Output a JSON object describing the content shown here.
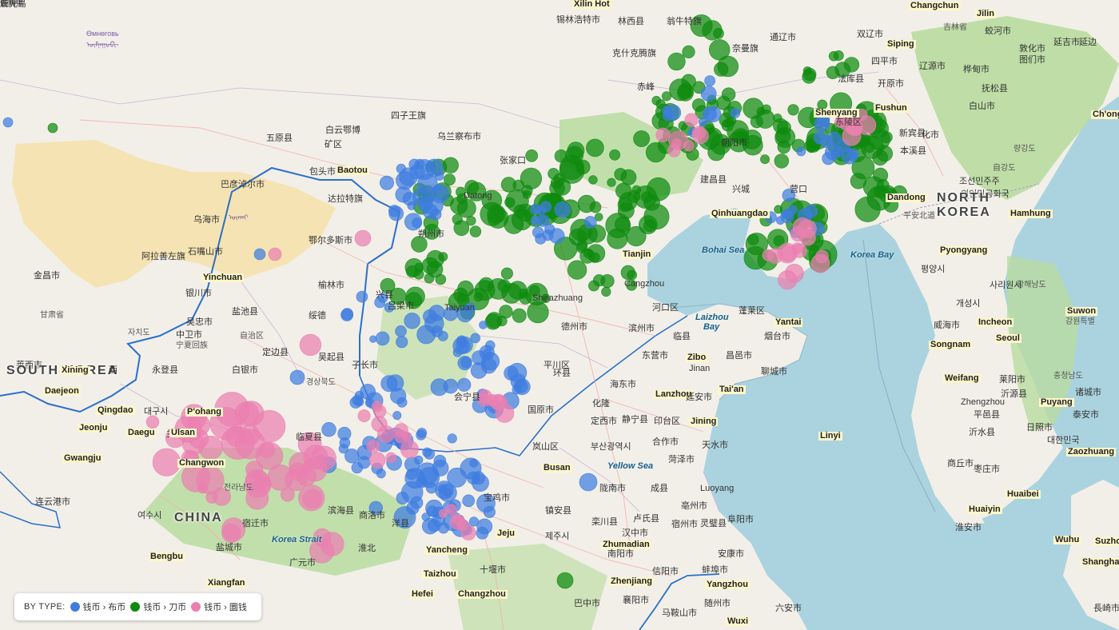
{
  "legend": {
    "title": "BY TYPE:",
    "items": [
      {
        "label": "钱币 › 布币",
        "color": "#3e7de0"
      },
      {
        "label": "钱币 › 刀币",
        "color": "#0e8a0e"
      },
      {
        "label": "钱币 › 圜钱",
        "color": "#ea7fb0"
      }
    ]
  },
  "colors": {
    "water": "#aad3df",
    "land": "#f2efe9",
    "steppe": "#f5e3b3",
    "green": "#b9dca0"
  },
  "labels": [
    {
      "text": "Xilin Hot",
      "cls": "hl"
    },
    {
      "text": "锡林浩特市",
      "cls": ""
    },
    {
      "text": "Changchun",
      "cls": "hl"
    },
    {
      "text": "Jilin",
      "cls": "hl"
    },
    {
      "text": "Өмнөговь",
      "cls": "mong"
    },
    {
      "text": "ᠥᠮᠨᠡᠭᠣᠪᠢ",
      "cls": "mong"
    },
    {
      "text": "林西县",
      "cls": ""
    },
    {
      "text": "翁牛特旗",
      "cls": ""
    },
    {
      "text": "克什克腾旗",
      "cls": ""
    },
    {
      "text": "奈曼旗",
      "cls": ""
    },
    {
      "text": "通辽市",
      "cls": ""
    },
    {
      "text": "双辽市",
      "cls": ""
    },
    {
      "text": "吉林省",
      "cls": "small"
    },
    {
      "text": "蛟河市",
      "cls": ""
    },
    {
      "text": "延吉市",
      "cls": ""
    },
    {
      "text": "延边",
      "cls": ""
    },
    {
      "text": "Siping",
      "cls": "hl"
    },
    {
      "text": "四平市",
      "cls": ""
    },
    {
      "text": "辽源市",
      "cls": ""
    },
    {
      "text": "桦甸市",
      "cls": ""
    },
    {
      "text": "敦化市",
      "cls": ""
    },
    {
      "text": "图们市",
      "cls": ""
    },
    {
      "text": "白山市",
      "cls": ""
    },
    {
      "text": "赤峰",
      "cls": ""
    },
    {
      "text": "法库县",
      "cls": ""
    },
    {
      "text": "开原市",
      "cls": ""
    },
    {
      "text": "抚松县",
      "cls": ""
    },
    {
      "text": "四子王旗",
      "cls": ""
    },
    {
      "text": "五原县",
      "cls": ""
    },
    {
      "text": "白云鄂博",
      "cls": ""
    },
    {
      "text": "矿区",
      "cls": ""
    },
    {
      "text": "乌兰察布市",
      "cls": ""
    },
    {
      "text": "Baotou",
      "cls": "hl"
    },
    {
      "text": "包头市",
      "cls": ""
    },
    {
      "text": "巴彦淖尔市",
      "cls": ""
    },
    {
      "text": "达拉特旗",
      "cls": ""
    },
    {
      "text": "张家口",
      "cls": ""
    },
    {
      "text": "Datong",
      "cls": ""
    },
    {
      "text": "朝阳市",
      "cls": ""
    },
    {
      "text": "Shenyang",
      "cls": "hl"
    },
    {
      "text": "Fushun",
      "cls": "hl"
    },
    {
      "text": "东陵区",
      "cls": ""
    },
    {
      "text": "新宾县",
      "cls": ""
    },
    {
      "text": "本溪县",
      "cls": ""
    },
    {
      "text": "化市",
      "cls": ""
    },
    {
      "text": "Ch'ong",
      "cls": "hl"
    },
    {
      "text": "량강도",
      "cls": "small"
    },
    {
      "text": "조선민주주",
      "cls": ""
    },
    {
      "text": "의인민공화국",
      "cls": ""
    },
    {
      "text": "自강도",
      "cls": "small"
    },
    {
      "text": "NORTH",
      "cls": "big"
    },
    {
      "text": "KOREA",
      "cls": "big"
    },
    {
      "text": "Hamhung",
      "cls": "hl"
    },
    {
      "text": "Dandong",
      "cls": "hl"
    },
    {
      "text": "平安北道",
      "cls": "small"
    },
    {
      "text": "乌海市",
      "cls": ""
    },
    {
      "text": "ᠦᠬᠠᠢ",
      "cls": "mong"
    },
    {
      "text": "鄂尔多斯市",
      "cls": ""
    },
    {
      "text": "阿拉善左旗",
      "cls": ""
    },
    {
      "text": "石嘴山市",
      "cls": ""
    },
    {
      "text": "朔州市",
      "cls": ""
    },
    {
      "text": "建昌县",
      "cls": ""
    },
    {
      "text": "兴城",
      "cls": ""
    },
    {
      "text": "营口",
      "cls": ""
    },
    {
      "text": "Qinhuangdao",
      "cls": "hl"
    },
    {
      "text": "Bohai Sea",
      "cls": "sea"
    },
    {
      "text": "Korea Bay",
      "cls": "sea"
    },
    {
      "text": "Pyongyang",
      "cls": "hl"
    },
    {
      "text": "평양시",
      "cls": ""
    },
    {
      "text": "金昌市",
      "cls": ""
    },
    {
      "text": "Yinchuan",
      "cls": "hl"
    },
    {
      "text": "银川市",
      "cls": ""
    },
    {
      "text": "甘肃省",
      "cls": "small"
    },
    {
      "text": "榆林市",
      "cls": ""
    },
    {
      "text": "Tianjin",
      "cls": "hl"
    },
    {
      "text": "Cangzhou",
      "cls": ""
    },
    {
      "text": "황해남도",
      "cls": "small"
    },
    {
      "text": "사리원시",
      "cls": ""
    },
    {
      "text": "개성시",
      "cls": ""
    },
    {
      "text": "盐池县",
      "cls": ""
    },
    {
      "text": "吴忠市",
      "cls": ""
    },
    {
      "text": "绥德",
      "cls": ""
    },
    {
      "text": "兴县",
      "cls": ""
    },
    {
      "text": "吕梁市",
      "cls": ""
    },
    {
      "text": "Taiyuan",
      "cls": ""
    },
    {
      "text": "Shijiazhuang",
      "cls": ""
    },
    {
      "text": "德州市",
      "cls": ""
    },
    {
      "text": "滨州市",
      "cls": ""
    },
    {
      "text": "河口区",
      "cls": ""
    },
    {
      "text": "蓬莱区",
      "cls": ""
    },
    {
      "text": "Laizhou",
      "cls": "sea"
    },
    {
      "text": "Bay",
      "cls": "sea"
    },
    {
      "text": "Yantai",
      "cls": "hl"
    },
    {
      "text": "烟台市",
      "cls": ""
    },
    {
      "text": "威海市",
      "cls": ""
    },
    {
      "text": "Incheon",
      "cls": "hl"
    },
    {
      "text": "Seoul",
      "cls": "hl"
    },
    {
      "text": "Songnam",
      "cls": "hl"
    },
    {
      "text": "Suwon",
      "cls": "hl"
    },
    {
      "text": "강원특별",
      "cls": "small"
    },
    {
      "text": "자치도",
      "cls": "small"
    },
    {
      "text": "中卫市",
      "cls": ""
    },
    {
      "text": "宁夏回族",
      "cls": "small"
    },
    {
      "text": "自治区",
      "cls": "small"
    },
    {
      "text": "定边县",
      "cls": ""
    },
    {
      "text": "吴起县",
      "cls": ""
    },
    {
      "text": "子长市",
      "cls": ""
    },
    {
      "text": "临县",
      "cls": ""
    },
    {
      "text": "东营市",
      "cls": ""
    },
    {
      "text": "Zibo",
      "cls": "hl"
    },
    {
      "text": "昌邑市",
      "cls": ""
    },
    {
      "text": "莱西市",
      "cls": ""
    },
    {
      "text": "SOUTH KOREA",
      "cls": "big"
    },
    {
      "text": "Xining",
      "cls": "hl"
    },
    {
      "text": "西",
      "cls": ""
    },
    {
      "text": "永登县",
      "cls": ""
    },
    {
      "text": "白银市",
      "cls": ""
    },
    {
      "text": "平川区",
      "cls": ""
    },
    {
      "text": "环县",
      "cls": ""
    },
    {
      "text": "Jinan",
      "cls": ""
    },
    {
      "text": "聊城市",
      "cls": ""
    },
    {
      "text": "Weifang",
      "cls": "hl"
    },
    {
      "text": "莱阳市",
      "cls": ""
    },
    {
      "text": "충청남도",
      "cls": "small"
    },
    {
      "text": "Daejeon",
      "cls": "hl"
    },
    {
      "text": "경상북도",
      "cls": "small"
    },
    {
      "text": "海东市",
      "cls": ""
    },
    {
      "text": "Lanzhou",
      "cls": "hl"
    },
    {
      "text": "延安市",
      "cls": ""
    },
    {
      "text": "Tai'an",
      "cls": "hl"
    },
    {
      "text": "沂源县",
      "cls": ""
    },
    {
      "text": "诸城市",
      "cls": ""
    },
    {
      "text": "Qingdao",
      "cls": "hl"
    },
    {
      "text": "대구시",
      "cls": ""
    },
    {
      "text": "P'ohang",
      "cls": "hl"
    },
    {
      "text": "兰州市",
      "cls": ""
    },
    {
      "text": "会宁县",
      "cls": ""
    },
    {
      "text": "国原市",
      "cls": ""
    },
    {
      "text": "化隆",
      "cls": ""
    },
    {
      "text": "Zhengzhou",
      "cls": ""
    },
    {
      "text": "Puyang",
      "cls": "hl"
    },
    {
      "text": "泰安市",
      "cls": ""
    },
    {
      "text": "Jeonju",
      "cls": "hl"
    },
    {
      "text": "Daegu",
      "cls": "hl"
    },
    {
      "text": "Ulsan",
      "cls": "hl"
    },
    {
      "text": "临夏县",
      "cls": ""
    },
    {
      "text": "定西市",
      "cls": ""
    },
    {
      "text": "静宁县",
      "cls": ""
    },
    {
      "text": "印台区",
      "cls": ""
    },
    {
      "text": "Jining",
      "cls": "hl"
    },
    {
      "text": "平邑县",
      "cls": ""
    },
    {
      "text": "沂水县",
      "cls": ""
    },
    {
      "text": "日照市",
      "cls": ""
    },
    {
      "text": "대한민국",
      "cls": ""
    },
    {
      "text": "Gwangju",
      "cls": "hl"
    },
    {
      "text": "Changwon",
      "cls": "hl"
    },
    {
      "text": "부산광역시",
      "cls": ""
    },
    {
      "text": "合作市",
      "cls": ""
    },
    {
      "text": "天水市",
      "cls": ""
    },
    {
      "text": "Zaozhuang",
      "cls": "hl"
    },
    {
      "text": "Linyi",
      "cls": "hl"
    },
    {
      "text": "岚山区",
      "cls": ""
    },
    {
      "text": "Busan",
      "cls": "hl"
    },
    {
      "text": "Yellow Sea",
      "cls": "sea"
    },
    {
      "text": "菏泽市",
      "cls": ""
    },
    {
      "text": "商丘市",
      "cls": ""
    },
    {
      "text": "枣庄市",
      "cls": ""
    },
    {
      "text": "连云港市",
      "cls": ""
    },
    {
      "text": "전라남도",
      "cls": "small"
    },
    {
      "text": "여수시",
      "cls": ""
    },
    {
      "text": "CHINA",
      "cls": "big"
    },
    {
      "text": "宝鸡市",
      "cls": ""
    },
    {
      "text": "陇南市",
      "cls": ""
    },
    {
      "text": "成县",
      "cls": ""
    },
    {
      "text": "Luoyang",
      "cls": ""
    },
    {
      "text": "Huaibei",
      "cls": "hl"
    },
    {
      "text": "宿迁市",
      "cls": ""
    },
    {
      "text": "滨海县",
      "cls": ""
    },
    {
      "text": "Korea Strait",
      "cls": "sea"
    },
    {
      "text": "洋县",
      "cls": ""
    },
    {
      "text": "商洛市",
      "cls": ""
    },
    {
      "text": "镇安县",
      "cls": ""
    },
    {
      "text": "栾川县",
      "cls": ""
    },
    {
      "text": "卢氏县",
      "cls": ""
    },
    {
      "text": "亳州市",
      "cls": ""
    },
    {
      "text": "宿州市",
      "cls": ""
    },
    {
      "text": "灵璧县",
      "cls": ""
    },
    {
      "text": "Huaiyin",
      "cls": "hl"
    },
    {
      "text": "淮安市",
      "cls": ""
    },
    {
      "text": "盐城市",
      "cls": ""
    },
    {
      "text": "Jeju",
      "cls": "hl"
    },
    {
      "text": "제주시",
      "cls": ""
    },
    {
      "text": "汉中市",
      "cls": ""
    },
    {
      "text": "Zhumadian",
      "cls": "hl"
    },
    {
      "text": "阜阳市",
      "cls": ""
    },
    {
      "text": "Bengbu",
      "cls": "hl"
    },
    {
      "text": "淮北",
      "cls": ""
    },
    {
      "text": "Yancheng",
      "cls": "hl"
    },
    {
      "text": "广元市",
      "cls": ""
    },
    {
      "text": "十堰市",
      "cls": ""
    },
    {
      "text": "南阳市",
      "cls": ""
    },
    {
      "text": "安康市",
      "cls": ""
    },
    {
      "text": "信阳市",
      "cls": ""
    },
    {
      "text": "蚌埠市",
      "cls": ""
    },
    {
      "text": "Taizhou",
      "cls": "hl"
    },
    {
      "text": "Zhenjiang",
      "cls": "hl"
    },
    {
      "text": "Yangzhou",
      "cls": "hl"
    },
    {
      "text": "Xiangfan",
      "cls": "hl"
    },
    {
      "text": "Hefei",
      "cls": "hl"
    },
    {
      "text": "Changzhou",
      "cls": "hl"
    },
    {
      "text": "巴中市",
      "cls": ""
    },
    {
      "text": "襄阳市",
      "cls": ""
    },
    {
      "text": "随州市",
      "cls": ""
    },
    {
      "text": "六安市",
      "cls": ""
    },
    {
      "text": "马鞍山市",
      "cls": ""
    },
    {
      "text": "Wuxi",
      "cls": "hl"
    },
    {
      "text": "Shanghai",
      "cls": "hl"
    },
    {
      "text": "Wuhu",
      "cls": "hl"
    },
    {
      "text": "Suzhou",
      "cls": "hl"
    },
    {
      "text": "長崎市",
      "cls": ""
    },
    {
      "text": "長崎県",
      "cls": "small"
    },
    {
      "text": "佐賀県",
      "cls": "small"
    },
    {
      "text": "鹿児島",
      "cls": ""
    }
  ]
}
